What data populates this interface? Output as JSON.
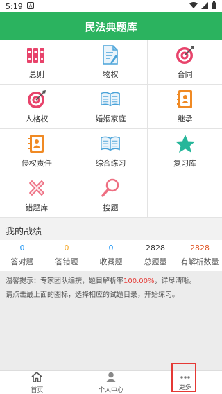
{
  "status": {
    "time": "5:19"
  },
  "header": {
    "title": "民法典题库"
  },
  "grid": {
    "items": [
      {
        "label": "总则"
      },
      {
        "label": "物权"
      },
      {
        "label": "合同"
      },
      {
        "label": "人格权"
      },
      {
        "label": "婚姻家庭"
      },
      {
        "label": "继承"
      },
      {
        "label": "侵权责任"
      },
      {
        "label": "综合练习"
      },
      {
        "label": "复习库"
      },
      {
        "label": "错题库"
      },
      {
        "label": "搜题"
      }
    ]
  },
  "record": {
    "title": "我的战绩",
    "stats": [
      {
        "value": "0",
        "label": "答对题",
        "color": "#2196f3"
      },
      {
        "value": "0",
        "label": "答错题",
        "color": "#f5a623"
      },
      {
        "value": "0",
        "label": "收藏题",
        "color": "#2196f3"
      },
      {
        "value": "2828",
        "label": "总题量",
        "color": "#333333"
      },
      {
        "value": "2828",
        "label": "有解析数量",
        "color": "#e05a2b"
      }
    ]
  },
  "tips": {
    "line1_pre": "温馨提示：专家团队编撰，题目解析率",
    "line1_rate": "100.00%",
    "line1_post": "，详尽清晰。",
    "line2": "请点击最上面的图标，选择相应的试题目录，开始练习。"
  },
  "tabbar": {
    "home": "首页",
    "personal": "个人中心",
    "more": "更多"
  },
  "colors": {
    "accent": "#2bb35f",
    "pink": "#e8436b",
    "blue": "#4aa3d9",
    "orange": "#f08a24",
    "teal": "#26b69a",
    "highlight": "#e53935"
  }
}
